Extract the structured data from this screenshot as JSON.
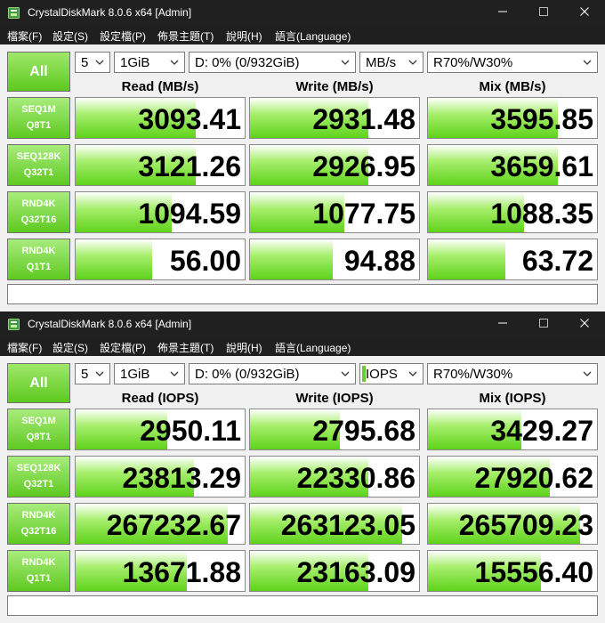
{
  "colors": {
    "accent": "#5ec920",
    "titlebar": "#202020",
    "menubar": "#1f1f1f"
  },
  "windows": [
    {
      "title": "CrystalDiskMark 8.0.6 x64 [Admin]",
      "menu": [
        "檔案(F)",
        "設定(S)",
        "設定檔(P)",
        "佈景主題(T)",
        "說明(H)",
        "語言(Language)"
      ],
      "all_label": "All",
      "count": "5",
      "size": "1GiB",
      "drive": "D: 0% (0/932GiB)",
      "unit": "MB/s",
      "mix_ratio": "R70%/W30%",
      "headers": {
        "read": "Read (MB/s)",
        "write": "Write (MB/s)",
        "mix": "Mix (MB/s)"
      },
      "rows": [
        {
          "line1": "SEQ1M",
          "line2": "Q8T1",
          "read": "3093.41",
          "write": "2931.48",
          "mix": "3595.85",
          "read_fill": 0.71,
          "write_fill": 0.7,
          "mix_fill": 0.77
        },
        {
          "line1": "SEQ128K",
          "line2": "Q32T1",
          "read": "3121.26",
          "write": "2926.95",
          "mix": "3659.61",
          "read_fill": 0.71,
          "write_fill": 0.7,
          "mix_fill": 0.77
        },
        {
          "line1": "RND4K",
          "line2": "Q32T16",
          "read": "1094.59",
          "write": "1077.75",
          "mix": "1088.35",
          "read_fill": 0.57,
          "write_fill": 0.56,
          "mix_fill": 0.57
        },
        {
          "line1": "RND4K",
          "line2": "Q1T1",
          "read": "56.00",
          "write": "94.88",
          "mix": "63.72",
          "read_fill": 0.45,
          "write_fill": 0.49,
          "mix_fill": 0.46
        }
      ],
      "comment": ""
    },
    {
      "title": "CrystalDiskMark 8.0.6 x64 [Admin]",
      "menu": [
        "檔案(F)",
        "設定(S)",
        "設定檔(P)",
        "佈景主題(T)",
        "說明(H)",
        "語言(Language)"
      ],
      "all_label": "All",
      "count": "5",
      "size": "1GiB",
      "drive": "D: 0% (0/932GiB)",
      "unit": "IOPS",
      "mix_ratio": "R70%/W30%",
      "headers": {
        "read": "Read (IOPS)",
        "write": "Write (IOPS)",
        "mix": "Mix (IOPS)"
      },
      "rows": [
        {
          "line1": "SEQ1M",
          "line2": "Q8T1",
          "read": "2950.11",
          "write": "2795.68",
          "mix": "3429.27",
          "read_fill": 0.54,
          "write_fill": 0.53,
          "mix_fill": 0.55
        },
        {
          "line1": "SEQ128K",
          "line2": "Q32T1",
          "read": "23813.29",
          "write": "22330.86",
          "mix": "27920.62",
          "read_fill": 0.7,
          "write_fill": 0.7,
          "mix_fill": 0.72
        },
        {
          "line1": "RND4K",
          "line2": "Q32T16",
          "read": "267232.67",
          "write": "263123.05",
          "mix": "265709.23",
          "read_fill": 0.9,
          "write_fill": 0.9,
          "mix_fill": 0.9
        },
        {
          "line1": "RND4K",
          "line2": "Q1T1",
          "read": "13671.88",
          "write": "23163.09",
          "mix": "15556.40",
          "read_fill": 0.66,
          "write_fill": 0.7,
          "mix_fill": 0.67
        }
      ],
      "comment": ""
    }
  ]
}
